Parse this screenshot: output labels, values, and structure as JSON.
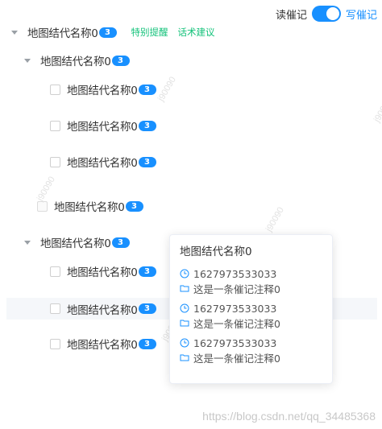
{
  "toggle": {
    "left_label": "读催记",
    "right_label": "写催记",
    "on": true
  },
  "tree": {
    "root": {
      "label": "地图结代名称0",
      "count": "3"
    },
    "actions": [
      "特别提醒",
      "话术建议"
    ],
    "group1": {
      "label": "地图结代名称0",
      "count": "3",
      "children": [
        {
          "label": "地图结代名称0",
          "count": "3"
        },
        {
          "label": "地图结代名称0",
          "count": "3"
        },
        {
          "label": "地图结代名称0",
          "count": "3"
        }
      ]
    },
    "loose_item": {
      "label": "地图结代名称0",
      "count": "3"
    },
    "group2": {
      "label": "地图结代名称0",
      "count": "3",
      "children": [
        {
          "label": "地图结代名称0",
          "count": "3"
        },
        {
          "label": "地图结代名称0",
          "count": "3"
        },
        {
          "label": "地图结代名称0",
          "count": "3"
        }
      ]
    }
  },
  "popover": {
    "title": "地图结代名称0",
    "entries": [
      {
        "time": "1627973533033",
        "note": "这是一条催记注释0"
      },
      {
        "time": "1627973533033",
        "note": "这是一条催记注释0"
      },
      {
        "time": "1627973533033",
        "note": "这是一条催记注释0"
      }
    ]
  },
  "watermarks": {
    "text": "j90090",
    "site": "https://blog.csdn.net/qq_34485368"
  },
  "colors": {
    "accent": "#1890ff",
    "action": "#13c27a",
    "text": "#333333",
    "watermark": "#e2e2e2"
  }
}
